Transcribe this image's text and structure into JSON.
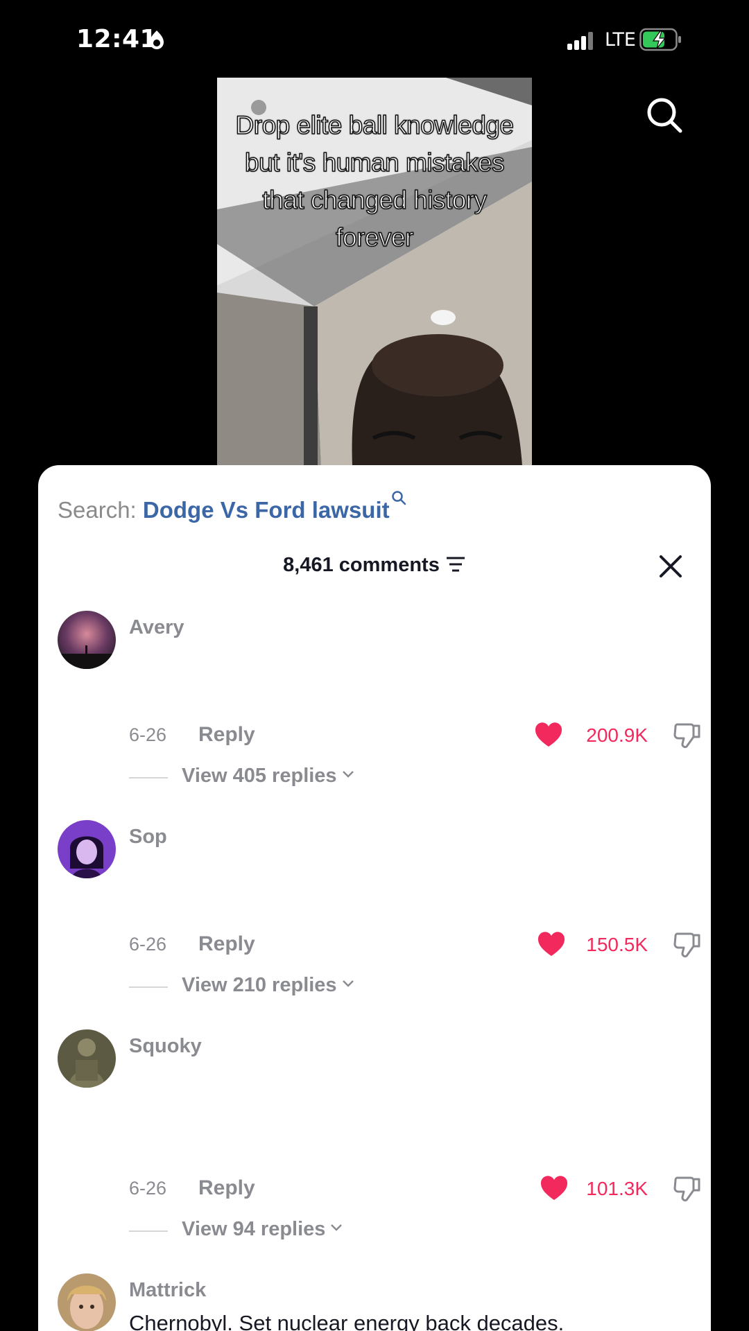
{
  "status_bar": {
    "time": "12:41",
    "network": "LTE"
  },
  "video": {
    "caption": "Drop elite ball knowledge but it's human mistakes that changed history forever"
  },
  "sheet": {
    "search_prefix": "Search:",
    "search_query": "Dodge Vs Ford lawsuit",
    "comment_count": "8,461 comments",
    "comments": [
      {
        "username": "Avery",
        "text": "",
        "date": "6-26",
        "reply_label": "Reply",
        "likes": "200.9K",
        "view_replies": "View 405 replies"
      },
      {
        "username": "Sop",
        "text": "",
        "date": "6-26",
        "reply_label": "Reply",
        "likes": "150.5K",
        "view_replies": "View 210 replies"
      },
      {
        "username": "Squoky",
        "text": "",
        "date": "6-26",
        "reply_label": "Reply",
        "likes": "101.3K",
        "view_replies": "View 94 replies"
      },
      {
        "username": "Mattrick",
        "text": "Chernobyl. Set nuclear energy back decades."
      }
    ]
  },
  "colors": {
    "like": "#f2295c",
    "search_link": "#3c67a6",
    "muted": "#8a8b91"
  },
  "icons": [
    "focus-icon",
    "signal-icon",
    "battery-icon",
    "search-icon",
    "filter-icon",
    "close-icon",
    "heart-icon",
    "dislike-icon",
    "chevron-down-icon"
  ]
}
